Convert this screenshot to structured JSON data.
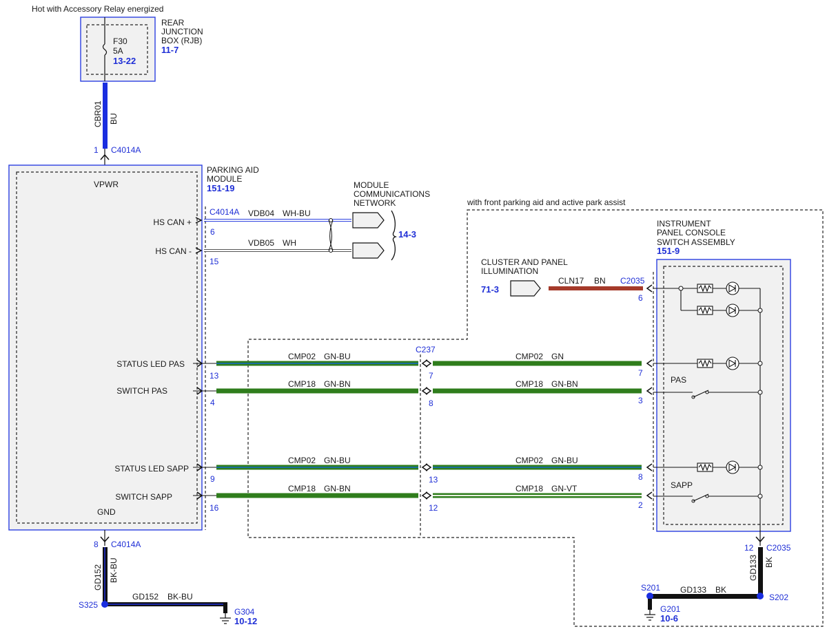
{
  "header_note": "Hot with Accessory Relay energized",
  "rjb": {
    "title_lines": [
      "REAR",
      "JUNCTION",
      "BOX (RJB)"
    ],
    "ref": "11-7",
    "fuse": {
      "id": "F30",
      "rating": "5A",
      "ref": "13-22"
    }
  },
  "power_wire": {
    "circuit": "CBR01",
    "color": "BU",
    "pin": "1",
    "connector": "C4014A"
  },
  "module": {
    "title_lines": [
      "PARKING AID",
      "MODULE"
    ],
    "ref": "151-19",
    "vpwr": "VPWR",
    "gnd": "GND",
    "pins": [
      {
        "label": "HS CAN +",
        "pin": "6"
      },
      {
        "label": "HS CAN -",
        "pin": "15"
      },
      {
        "label": "STATUS LED PAS",
        "pin": "13"
      },
      {
        "label": "SWITCH PAS",
        "pin": "4"
      },
      {
        "label": "STATUS LED SAPP",
        "pin": "9"
      },
      {
        "label": "SWITCH SAPP",
        "pin": "16"
      }
    ],
    "can_connector": "C4014A"
  },
  "network": {
    "title_lines": [
      "MODULE",
      "COMMUNICATIONS",
      "NETWORK"
    ],
    "ref": "14-3",
    "wires": [
      {
        "circuit": "VDB04",
        "color": "WH-BU"
      },
      {
        "circuit": "VDB05",
        "color": "WH"
      }
    ]
  },
  "option_note": "with front parking aid and active park assist",
  "switch_assembly": {
    "title_lines": [
      "INSTRUMENT",
      "PANEL CONSOLE",
      "SWITCH ASSEMBLY"
    ],
    "ref": "151-9",
    "pas": "PAS",
    "sapp": "SAPP"
  },
  "illumination": {
    "title_lines": [
      "CLUSTER AND PANEL",
      "ILLUMINATION"
    ],
    "ref": "71-3",
    "circuit": "CLN17",
    "color": "BN",
    "connector": "C2035",
    "pin": "6"
  },
  "inline_connector": "C237",
  "wires": [
    {
      "left": {
        "circuit": "CMP02",
        "color": "GN-BU"
      },
      "mid_pin": "7",
      "right": {
        "circuit": "CMP02",
        "color": "GN"
      },
      "end_pin": "7"
    },
    {
      "left": {
        "circuit": "CMP18",
        "color": "GN-BN"
      },
      "mid_pin": "8",
      "right": {
        "circuit": "CMP18",
        "color": "GN-BN"
      },
      "end_pin": "3"
    },
    {
      "left": {
        "circuit": "CMP02",
        "color": "GN-BU"
      },
      "mid_pin": "13",
      "right": {
        "circuit": "CMP02",
        "color": "GN-BU"
      },
      "end_pin": "8"
    },
    {
      "left": {
        "circuit": "CMP18",
        "color": "GN-BN"
      },
      "mid_pin": "12",
      "right": {
        "circuit": "CMP18",
        "color": "GN-VT"
      },
      "end_pin": "2"
    }
  ],
  "ground_left": {
    "pin": "8",
    "connector": "C4014A",
    "circuit": "GD152",
    "color": "BK-BU",
    "splice": "S325",
    "ground": "G304",
    "ground_ref": "10-12"
  },
  "ground_right": {
    "pin": "12",
    "connector": "C2035",
    "circuit": "GD133",
    "color": "BK",
    "splice_right": "S202",
    "splice_left": "S201",
    "ground": "G201",
    "ground_ref": "10-6"
  },
  "colors": {
    "blue_wire": "#1a2ee0",
    "green_wire": "#2f7d1c",
    "green_blue_stripe": "#1a6fa0",
    "brown_wire": "#a53a2a",
    "black_wire": "#111111",
    "pin_text": "#1f2fd6",
    "box_fill": "#f1f1f1"
  }
}
